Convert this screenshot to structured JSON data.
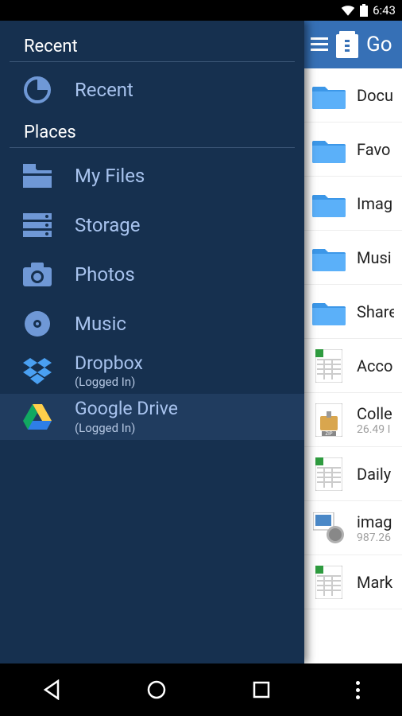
{
  "status": {
    "time": "6:43"
  },
  "drawer": {
    "section_recent": "Recent",
    "recent_item": {
      "label": "Recent"
    },
    "section_places": "Places",
    "places": [
      {
        "icon": "folder",
        "label": "My Files"
      },
      {
        "icon": "storage",
        "label": "Storage"
      },
      {
        "icon": "camera",
        "label": "Photos"
      },
      {
        "icon": "disc",
        "label": "Music"
      },
      {
        "icon": "dropbox",
        "label": "Dropbox",
        "sub": "(Logged In)"
      },
      {
        "icon": "gdrive",
        "label": "Google Drive",
        "sub": "(Logged In)",
        "selected": true
      }
    ]
  },
  "actionbar": {
    "title": "Go"
  },
  "files": [
    {
      "type": "folder",
      "name": "Docu"
    },
    {
      "type": "folder",
      "name": "Favo"
    },
    {
      "type": "folder",
      "name": "Imag"
    },
    {
      "type": "folder",
      "name": "Musi"
    },
    {
      "type": "folder",
      "name": "Share"
    },
    {
      "type": "sheet",
      "name": "Acco"
    },
    {
      "type": "zip",
      "name": "Colle",
      "sub": "26.49 I"
    },
    {
      "type": "sheet",
      "name": "Daily"
    },
    {
      "type": "image",
      "name": "imag",
      "sub": "987.26"
    },
    {
      "type": "sheet",
      "name": "Mark"
    }
  ]
}
